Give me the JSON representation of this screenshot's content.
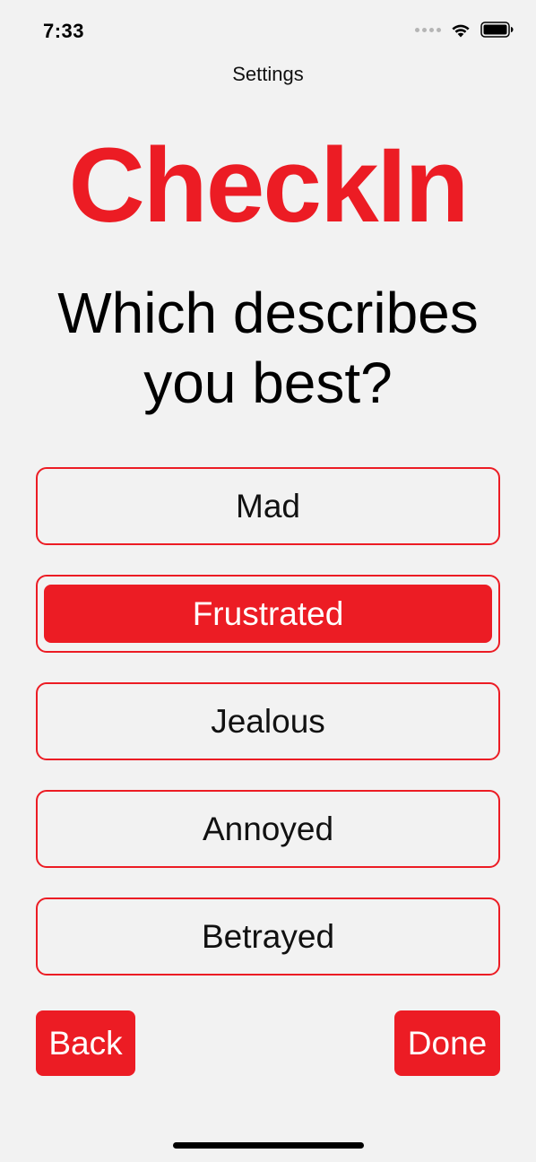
{
  "status_bar": {
    "time": "7:33",
    "signal_icon": "cellular-signal-dots",
    "wifi_icon": "wifi-icon",
    "battery_icon": "battery-icon"
  },
  "header": {
    "settings_label": "Settings"
  },
  "app": {
    "title": "CheckIn",
    "accent_color": "#ec1c24"
  },
  "question": {
    "line1": "Which describes",
    "line2": "you best?"
  },
  "options": [
    {
      "label": "Mad",
      "selected": false
    },
    {
      "label": "Frustrated",
      "selected": true
    },
    {
      "label": "Jealous",
      "selected": false
    },
    {
      "label": "Annoyed",
      "selected": false
    },
    {
      "label": "Betrayed",
      "selected": false
    }
  ],
  "navigation": {
    "back_label": "Back",
    "done_label": "Done"
  }
}
